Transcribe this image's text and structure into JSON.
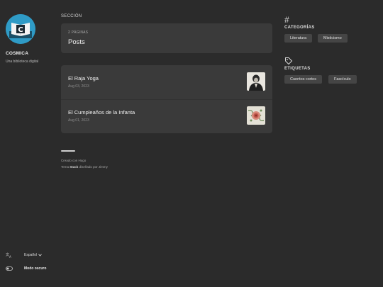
{
  "site": {
    "name": "COSMICA",
    "description": "Una biblioteca digital"
  },
  "sidebar": {
    "language_label": "Español",
    "dark_mode_label": "Modo oscuro"
  },
  "main": {
    "section_heading": "SECCIÓN",
    "section_card": {
      "count_label": "2 PÁGINAS",
      "name": "Posts"
    },
    "articles": [
      {
        "title": "El Raja Yoga",
        "date": "Aug 03, 2023"
      },
      {
        "title": "El Cumpleaños de la Infanta",
        "date": "Aug 01, 2023"
      }
    ],
    "footer": {
      "created_with": "Creado con Hugo",
      "theme_prefix": "Tema",
      "theme_name": "Stack",
      "theme_suffix": "diseñado por Jimmy"
    }
  },
  "right_sidebar": {
    "categories": {
      "title": "CATEGORÍAS",
      "items": [
        "Literatura",
        "Misticismo"
      ]
    },
    "tags": {
      "title": "ETIQUETAS",
      "items": [
        "Cuentos cortos",
        "Fascículo"
      ]
    }
  },
  "icons": {
    "category_icon": "hash-icon",
    "tag_icon": "tag-icon",
    "language_icon": "translate-icon",
    "dark_mode_icon": "toggle-icon"
  },
  "colors": {
    "background": "#2b2b2b",
    "card": "#3a3a3a",
    "avatar_blue": "#2f9bc6"
  }
}
